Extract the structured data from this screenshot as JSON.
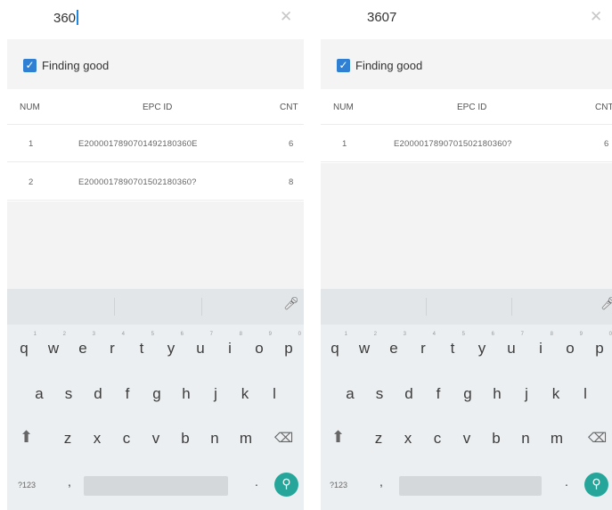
{
  "screens": [
    {
      "search_text": "360",
      "filter_label": "Finding good",
      "columns": [
        "NUM",
        "EPC ID",
        "CNT"
      ],
      "rows": [
        {
          "num": "1",
          "epc": "E2000017890701492180360E",
          "cnt": "6"
        },
        {
          "num": "2",
          "epc": "E2000017890701502180360?",
          "cnt": "8"
        }
      ]
    },
    {
      "search_text": "3607",
      "filter_label": "Finding good",
      "columns": [
        "NUM",
        "EPC ID",
        "CNT"
      ],
      "rows": [
        {
          "num": "1",
          "epc": "E2000017890701502180360?",
          "cnt": "6"
        }
      ]
    }
  ],
  "keyboard": {
    "row1": [
      "q",
      "w",
      "e",
      "r",
      "t",
      "y",
      "u",
      "i",
      "o",
      "p"
    ],
    "row1_hints": [
      "1",
      "2",
      "3",
      "4",
      "5",
      "6",
      "7",
      "8",
      "9",
      "0"
    ],
    "row2": [
      "a",
      "s",
      "d",
      "f",
      "g",
      "h",
      "j",
      "k",
      "l"
    ],
    "row3": [
      "z",
      "x",
      "c",
      "v",
      "b",
      "n",
      "m"
    ],
    "symbols_key": "?123",
    "comma": ",",
    "period": ".",
    "icons": {
      "clear": "close-icon",
      "mic": "microphone-icon",
      "shift": "shift-icon",
      "backspace": "backspace-icon",
      "search": "search-icon"
    },
    "accent_color": "#26a69a"
  },
  "colors": {
    "checkbox": "#2f7fd3",
    "caret": "#1e88e5"
  }
}
